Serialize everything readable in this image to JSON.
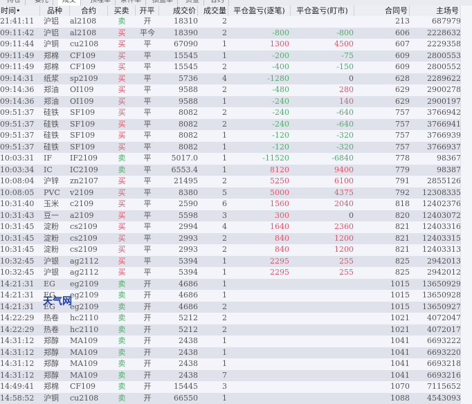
{
  "tabs": [
    {
      "label": "持仓"
    },
    {
      "label": "委托"
    },
    {
      "label": "成交"
    },
    {
      "label": "预埋单"
    },
    {
      "label": "条件单"
    },
    {
      "label": "损益单"
    },
    {
      "label": "资金"
    },
    {
      "label": "合约"
    }
  ],
  "active_tab": "成交",
  "columns": {
    "time": "时间",
    "time_sort_marker": "•",
    "variety": "品种",
    "contract": "合约",
    "side": "买卖",
    "open_close": "开平",
    "price": "成交价",
    "qty": "成交量",
    "pl_per_trade": "平仓盈亏(逐笔)",
    "pl_mark_to_market": "平仓盈亏(盯市)",
    "contract_no": "合同号",
    "main_no": "主场号"
  },
  "colors": {
    "buy": "#e0566a",
    "sell": "#4fae6a",
    "row_light": "#f3f5fa",
    "row_dark": "#dfe2ea"
  },
  "rows": [
    {
      "time": "21:41:11",
      "variety": "沪铝",
      "contract": "al2108",
      "side": "卖",
      "oc": "开",
      "price": "18310",
      "qty": "2",
      "pl1": "",
      "pl2": "",
      "contract_no": "213",
      "main_no": "687979"
    },
    {
      "time": "09:11:42",
      "variety": "沪铝",
      "contract": "al2108",
      "side": "买",
      "oc": "平今",
      "price": "18390",
      "qty": "2",
      "pl1": "-800",
      "pl2": "-800",
      "contract_no": "606",
      "main_no": "2228632"
    },
    {
      "time": "09:11:44",
      "variety": "沪铜",
      "contract": "cu2108",
      "side": "买",
      "oc": "平",
      "price": "67090",
      "qty": "1",
      "pl1": "1300",
      "pl2": "4500",
      "contract_no": "607",
      "main_no": "2229358"
    },
    {
      "time": "09:11:49",
      "variety": "郑棉",
      "contract": "CF109",
      "side": "买",
      "oc": "平",
      "price": "15545",
      "qty": "1",
      "pl1": "-200",
      "pl2": "-75",
      "contract_no": "609",
      "main_no": "2800553"
    },
    {
      "time": "09:11:49",
      "variety": "郑棉",
      "contract": "CF109",
      "side": "买",
      "oc": "平",
      "price": "15545",
      "qty": "2",
      "pl1": "-400",
      "pl2": "-150",
      "contract_no": "609",
      "main_no": "2800552"
    },
    {
      "time": "09:14:31",
      "variety": "纸浆",
      "contract": "sp2109",
      "side": "买",
      "oc": "平",
      "price": "5736",
      "qty": "4",
      "pl1": "-1280",
      "pl2": "0",
      "contract_no": "628",
      "main_no": "2289622"
    },
    {
      "time": "09:14:36",
      "variety": "郑油",
      "contract": "OI109",
      "side": "买",
      "oc": "平",
      "price": "9588",
      "qty": "2",
      "pl1": "-480",
      "pl2": "280",
      "contract_no": "629",
      "main_no": "2900278"
    },
    {
      "time": "09:14:36",
      "variety": "郑油",
      "contract": "OI109",
      "side": "买",
      "oc": "平",
      "price": "9588",
      "qty": "1",
      "pl1": "-240",
      "pl2": "140",
      "contract_no": "629",
      "main_no": "2900197"
    },
    {
      "time": "09:51:37",
      "variety": "硅铁",
      "contract": "SF109",
      "side": "买",
      "oc": "平",
      "price": "8082",
      "qty": "2",
      "pl1": "-240",
      "pl2": "-640",
      "contract_no": "757",
      "main_no": "3766942"
    },
    {
      "time": "09:51:37",
      "variety": "硅铁",
      "contract": "SF109",
      "side": "买",
      "oc": "平",
      "price": "8082",
      "qty": "2",
      "pl1": "-240",
      "pl2": "-640",
      "contract_no": "757",
      "main_no": "3766941"
    },
    {
      "time": "09:51:37",
      "variety": "硅铁",
      "contract": "SF109",
      "side": "买",
      "oc": "平",
      "price": "8082",
      "qty": "1",
      "pl1": "-120",
      "pl2": "-320",
      "contract_no": "757",
      "main_no": "3766939"
    },
    {
      "time": "09:51:37",
      "variety": "硅铁",
      "contract": "SF109",
      "side": "买",
      "oc": "平",
      "price": "8082",
      "qty": "1",
      "pl1": "-120",
      "pl2": "-320",
      "contract_no": "757",
      "main_no": "3766937"
    },
    {
      "time": "10:03:31",
      "variety": "IF",
      "contract": "IF2109",
      "side": "卖",
      "oc": "平",
      "price": "5017.0",
      "qty": "1",
      "pl1": "-11520",
      "pl2": "-6840",
      "contract_no": "778",
      "main_no": "98367"
    },
    {
      "time": "10:03:34",
      "variety": "IC",
      "contract": "IC2109",
      "side": "卖",
      "oc": "平",
      "price": "6553.4",
      "qty": "1",
      "pl1": "8120",
      "pl2": "9400",
      "contract_no": "779",
      "main_no": "98387"
    },
    {
      "time": "10:08:04",
      "variety": "沪锌",
      "contract": "zn2107",
      "side": "买",
      "oc": "平",
      "price": "21495",
      "qty": "2",
      "pl1": "5250",
      "pl2": "6100",
      "contract_no": "791",
      "main_no": "2855126"
    },
    {
      "time": "10:08:05",
      "variety": "PVC",
      "contract": "v2109",
      "side": "买",
      "oc": "平",
      "price": "8380",
      "qty": "5",
      "pl1": "5000",
      "pl2": "4375",
      "contract_no": "792",
      "main_no": "12308335"
    },
    {
      "time": "10:31:40",
      "variety": "玉米",
      "contract": "c2109",
      "side": "买",
      "oc": "平",
      "price": "2590",
      "qty": "6",
      "pl1": "1560",
      "pl2": "2040",
      "contract_no": "818",
      "main_no": "12402376"
    },
    {
      "time": "10:31:43",
      "variety": "豆一",
      "contract": "a2109",
      "side": "买",
      "oc": "平",
      "price": "5598",
      "qty": "3",
      "pl1": "300",
      "pl2": "0",
      "contract_no": "820",
      "main_no": "12403072"
    },
    {
      "time": "10:31:45",
      "variety": "淀粉",
      "contract": "cs2109",
      "side": "买",
      "oc": "平",
      "price": "2994",
      "qty": "4",
      "pl1": "1640",
      "pl2": "2360",
      "contract_no": "821",
      "main_no": "12403316"
    },
    {
      "time": "10:31:45",
      "variety": "淀粉",
      "contract": "cs2109",
      "side": "买",
      "oc": "平",
      "price": "2993",
      "qty": "2",
      "pl1": "840",
      "pl2": "1200",
      "contract_no": "821",
      "main_no": "12403315"
    },
    {
      "time": "10:31:45",
      "variety": "淀粉",
      "contract": "cs2109",
      "side": "买",
      "oc": "平",
      "price": "2993",
      "qty": "2",
      "pl1": "840",
      "pl2": "1200",
      "contract_no": "821",
      "main_no": "12403313"
    },
    {
      "time": "10:32:45",
      "variety": "沪银",
      "contract": "ag2112",
      "side": "买",
      "oc": "平",
      "price": "5394",
      "qty": "1",
      "pl1": "2295",
      "pl2": "255",
      "contract_no": "825",
      "main_no": "2942013"
    },
    {
      "time": "10:32:45",
      "variety": "沪银",
      "contract": "ag2112",
      "side": "买",
      "oc": "平",
      "price": "5394",
      "qty": "1",
      "pl1": "2295",
      "pl2": "255",
      "contract_no": "825",
      "main_no": "2942012"
    },
    {
      "time": "14:21:31",
      "variety": "EG",
      "contract": "eg2109",
      "side": "卖",
      "oc": "开",
      "price": "4686",
      "qty": "1",
      "pl1": "",
      "pl2": "",
      "contract_no": "1015",
      "main_no": "13650929"
    },
    {
      "time": "14:21:31",
      "variety": "EG",
      "contract": "eg2109",
      "side": "卖",
      "oc": "开",
      "price": "4686",
      "qty": "1",
      "pl1": "",
      "pl2": "",
      "contract_no": "1015",
      "main_no": "13650928"
    },
    {
      "time": "14:21:31",
      "variety": "EG",
      "contract": "eg2109",
      "side": "卖",
      "oc": "开",
      "price": "4686",
      "qty": "2",
      "pl1": "",
      "pl2": "",
      "contract_no": "1015",
      "main_no": "13650927"
    },
    {
      "time": "14:22:29",
      "variety": "热卷",
      "contract": "hc2110",
      "side": "卖",
      "oc": "开",
      "price": "5212",
      "qty": "2",
      "pl1": "",
      "pl2": "",
      "contract_no": "1021",
      "main_no": "4072047"
    },
    {
      "time": "14:22:29",
      "variety": "热卷",
      "contract": "hc2110",
      "side": "卖",
      "oc": "开",
      "price": "5212",
      "qty": "2",
      "pl1": "",
      "pl2": "",
      "contract_no": "1021",
      "main_no": "4072017"
    },
    {
      "time": "14:31:12",
      "variety": "郑醇",
      "contract": "MA109",
      "side": "卖",
      "oc": "开",
      "price": "2438",
      "qty": "1",
      "pl1": "",
      "pl2": "",
      "contract_no": "1041",
      "main_no": "6693222"
    },
    {
      "time": "14:31:12",
      "variety": "郑醇",
      "contract": "MA109",
      "side": "卖",
      "oc": "开",
      "price": "2438",
      "qty": "1",
      "pl1": "",
      "pl2": "",
      "contract_no": "1041",
      "main_no": "6693220"
    },
    {
      "time": "14:31:12",
      "variety": "郑醇",
      "contract": "MA109",
      "side": "卖",
      "oc": "开",
      "price": "2438",
      "qty": "1",
      "pl1": "",
      "pl2": "",
      "contract_no": "1041",
      "main_no": "6693218"
    },
    {
      "time": "14:31:12",
      "variety": "郑醇",
      "contract": "MA109",
      "side": "卖",
      "oc": "开",
      "price": "2438",
      "qty": "7",
      "pl1": "",
      "pl2": "",
      "contract_no": "1041",
      "main_no": "6693216"
    },
    {
      "time": "14:49:41",
      "variety": "郑棉",
      "contract": "CF109",
      "side": "卖",
      "oc": "开",
      "price": "15445",
      "qty": "3",
      "pl1": "",
      "pl2": "",
      "contract_no": "1070",
      "main_no": "7115652"
    },
    {
      "time": "14:58:52",
      "variety": "沪铜",
      "contract": "cu2108",
      "side": "卖",
      "oc": "开",
      "price": "66550",
      "qty": "1",
      "pl1": "",
      "pl2": "",
      "contract_no": "1088",
      "main_no": "4543093"
    }
  ],
  "watermark": "天气网"
}
